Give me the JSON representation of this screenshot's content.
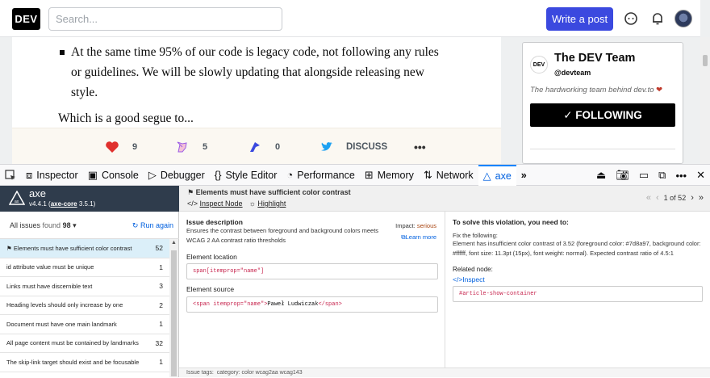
{
  "site": {
    "logo": "DEV",
    "search_placeholder": "Search...",
    "write_post": "Write a post"
  },
  "article": {
    "bullet": "At the same time 95% of our code is legacy code, not following any rules or guidelines. We will be slowly updating that alongside releasing new style.",
    "segue": "Which is a good segue to...",
    "reactions": [
      {
        "icon": "heart-icon",
        "count": "9",
        "color": "#e0312e"
      },
      {
        "icon": "unicorn-icon",
        "count": "5",
        "color": "#9b5de5"
      },
      {
        "icon": "bookmark-icon",
        "count": "0",
        "color": "#3b49df"
      }
    ],
    "discuss": "DISCUSS",
    "more": "•••"
  },
  "sidebar": {
    "logo_text": "DEV",
    "team_name": "The DEV Team",
    "handle": "@devteam",
    "description": "The hardworking team behind dev.to",
    "follow": "✓ FOLLOWING"
  },
  "devtools": {
    "tabs": [
      {
        "label": "Inspector",
        "icon": "inspector-icon"
      },
      {
        "label": "Console",
        "icon": "console-icon"
      },
      {
        "label": "Debugger",
        "icon": "debugger-icon"
      },
      {
        "label": "Style Editor",
        "icon": "style-editor-icon"
      },
      {
        "label": "Performance",
        "icon": "performance-icon"
      },
      {
        "label": "Memory",
        "icon": "memory-icon"
      },
      {
        "label": "Network",
        "icon": "network-icon"
      },
      {
        "label": "axe",
        "icon": "axe-icon"
      }
    ]
  },
  "axe": {
    "name": "axe",
    "version": "v4.4.1",
    "core": "axe-core",
    "core_version": "3.5.1",
    "all_issues_label": "All issues",
    "found_label": "found",
    "found_count": "98",
    "run_again": "Run again",
    "issues": [
      {
        "label": "Elements must have sufficient color contrast",
        "count": "52",
        "selected": true
      },
      {
        "label": "id attribute value must be unique",
        "count": "1"
      },
      {
        "label": "Links must have discernible text",
        "count": "3"
      },
      {
        "label": "Heading levels should only increase by one",
        "count": "2"
      },
      {
        "label": "Document must have one main landmark",
        "count": "1"
      },
      {
        "label": "All page content must be contained by landmarks",
        "count": "32"
      },
      {
        "label": "The skip-link target should exist and be focusable",
        "count": "1"
      }
    ],
    "detail": {
      "title": "Elements must have sufficient color contrast",
      "inspect_node": "Inspect Node",
      "highlight": "Highlight",
      "pager": "1 of 52",
      "issue_description_title": "Issue description",
      "issue_description": "Ensures the contrast between foreground and background colors meets WCAG 2 AA contrast ratio thresholds",
      "impact_label": "Impact:",
      "impact_value": "serious",
      "learn_more": "Learn more",
      "element_location_title": "Element location",
      "element_location": "span[itemprop=\"name\"]",
      "element_source_title": "Element source",
      "element_source_tag_open": "<span itemprop=\"name\">",
      "element_source_text": "Paweł Ludwiczak",
      "element_source_tag_close": "</span>",
      "solve_title": "To solve this violation, you need to:",
      "fix_label": "Fix the following:",
      "fix_text": "Element has insufficient color contrast of 3.52 (foreground color: #7d8a97, background color: #ffffff, font size: 11.3pt (15px), font weight: normal). Expected contrast ratio of 4.5:1",
      "related_node": "Related node:",
      "inspect": "Inspect",
      "related_selector": "#article-show-container",
      "issue_tags": "Issue tags:",
      "tags": "category: color   wcag2aa   wcag143"
    }
  }
}
